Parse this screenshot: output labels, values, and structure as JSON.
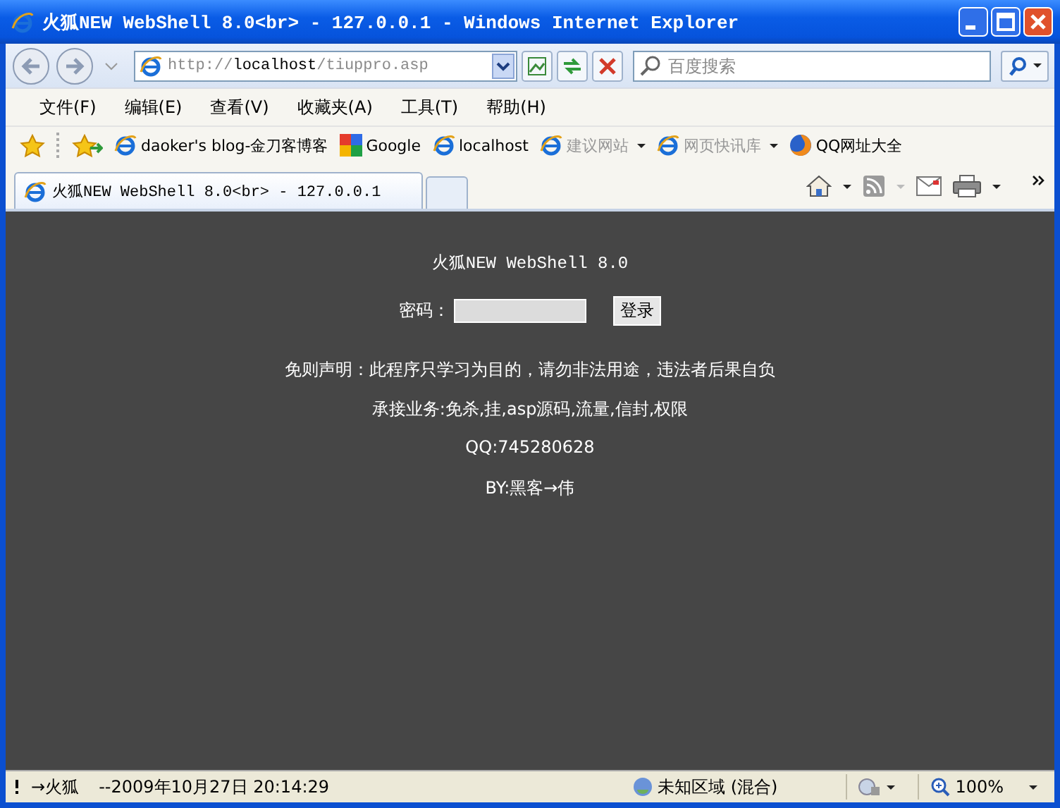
{
  "window": {
    "title": "火狐NEW WebShell 8.0<br> - 127.0.0.1 - Windows Internet Explorer"
  },
  "address": {
    "scheme": "http://",
    "host": "localhost",
    "path": "/tiuppro.asp"
  },
  "search": {
    "placeholder": "百度搜索"
  },
  "menu": [
    "文件(F)",
    "编辑(E)",
    "查看(V)",
    "收藏夹(A)",
    "工具(T)",
    "帮助(H)"
  ],
  "favorites": [
    {
      "label": "daoker's blog-金刀客博客",
      "kind": "page",
      "disabled": false,
      "dropdown": false
    },
    {
      "label": "Google",
      "kind": "google",
      "disabled": false,
      "dropdown": false
    },
    {
      "label": "localhost",
      "kind": "page",
      "disabled": false,
      "dropdown": false
    },
    {
      "label": "建议网站",
      "kind": "page",
      "disabled": true,
      "dropdown": true
    },
    {
      "label": "网页快讯库",
      "kind": "page",
      "disabled": true,
      "dropdown": true
    },
    {
      "label": "QQ网址大全",
      "kind": "firefox",
      "disabled": false,
      "dropdown": false
    }
  ],
  "tabs": [
    {
      "label": "火狐NEW WebShell 8.0<br> - 127.0.0.1",
      "selected": true
    }
  ],
  "page": {
    "heading": "火狐NEW WebShell 8.0",
    "password_label": "密码：",
    "login_button": "登录",
    "lines": [
      "免则声明：此程序只学习为目的，请勿非法用途，违法者后果自负",
      "承接业务:免杀,挂,asp源码,流量,信封,权限",
      "QQ:745280628",
      "BY:黑客→伟"
    ]
  },
  "status_bar": {
    "message": "→火狐",
    "date": "--2009年10月27日 20:14:29",
    "zone": "未知区域 (混合)",
    "zoom": "100%"
  }
}
